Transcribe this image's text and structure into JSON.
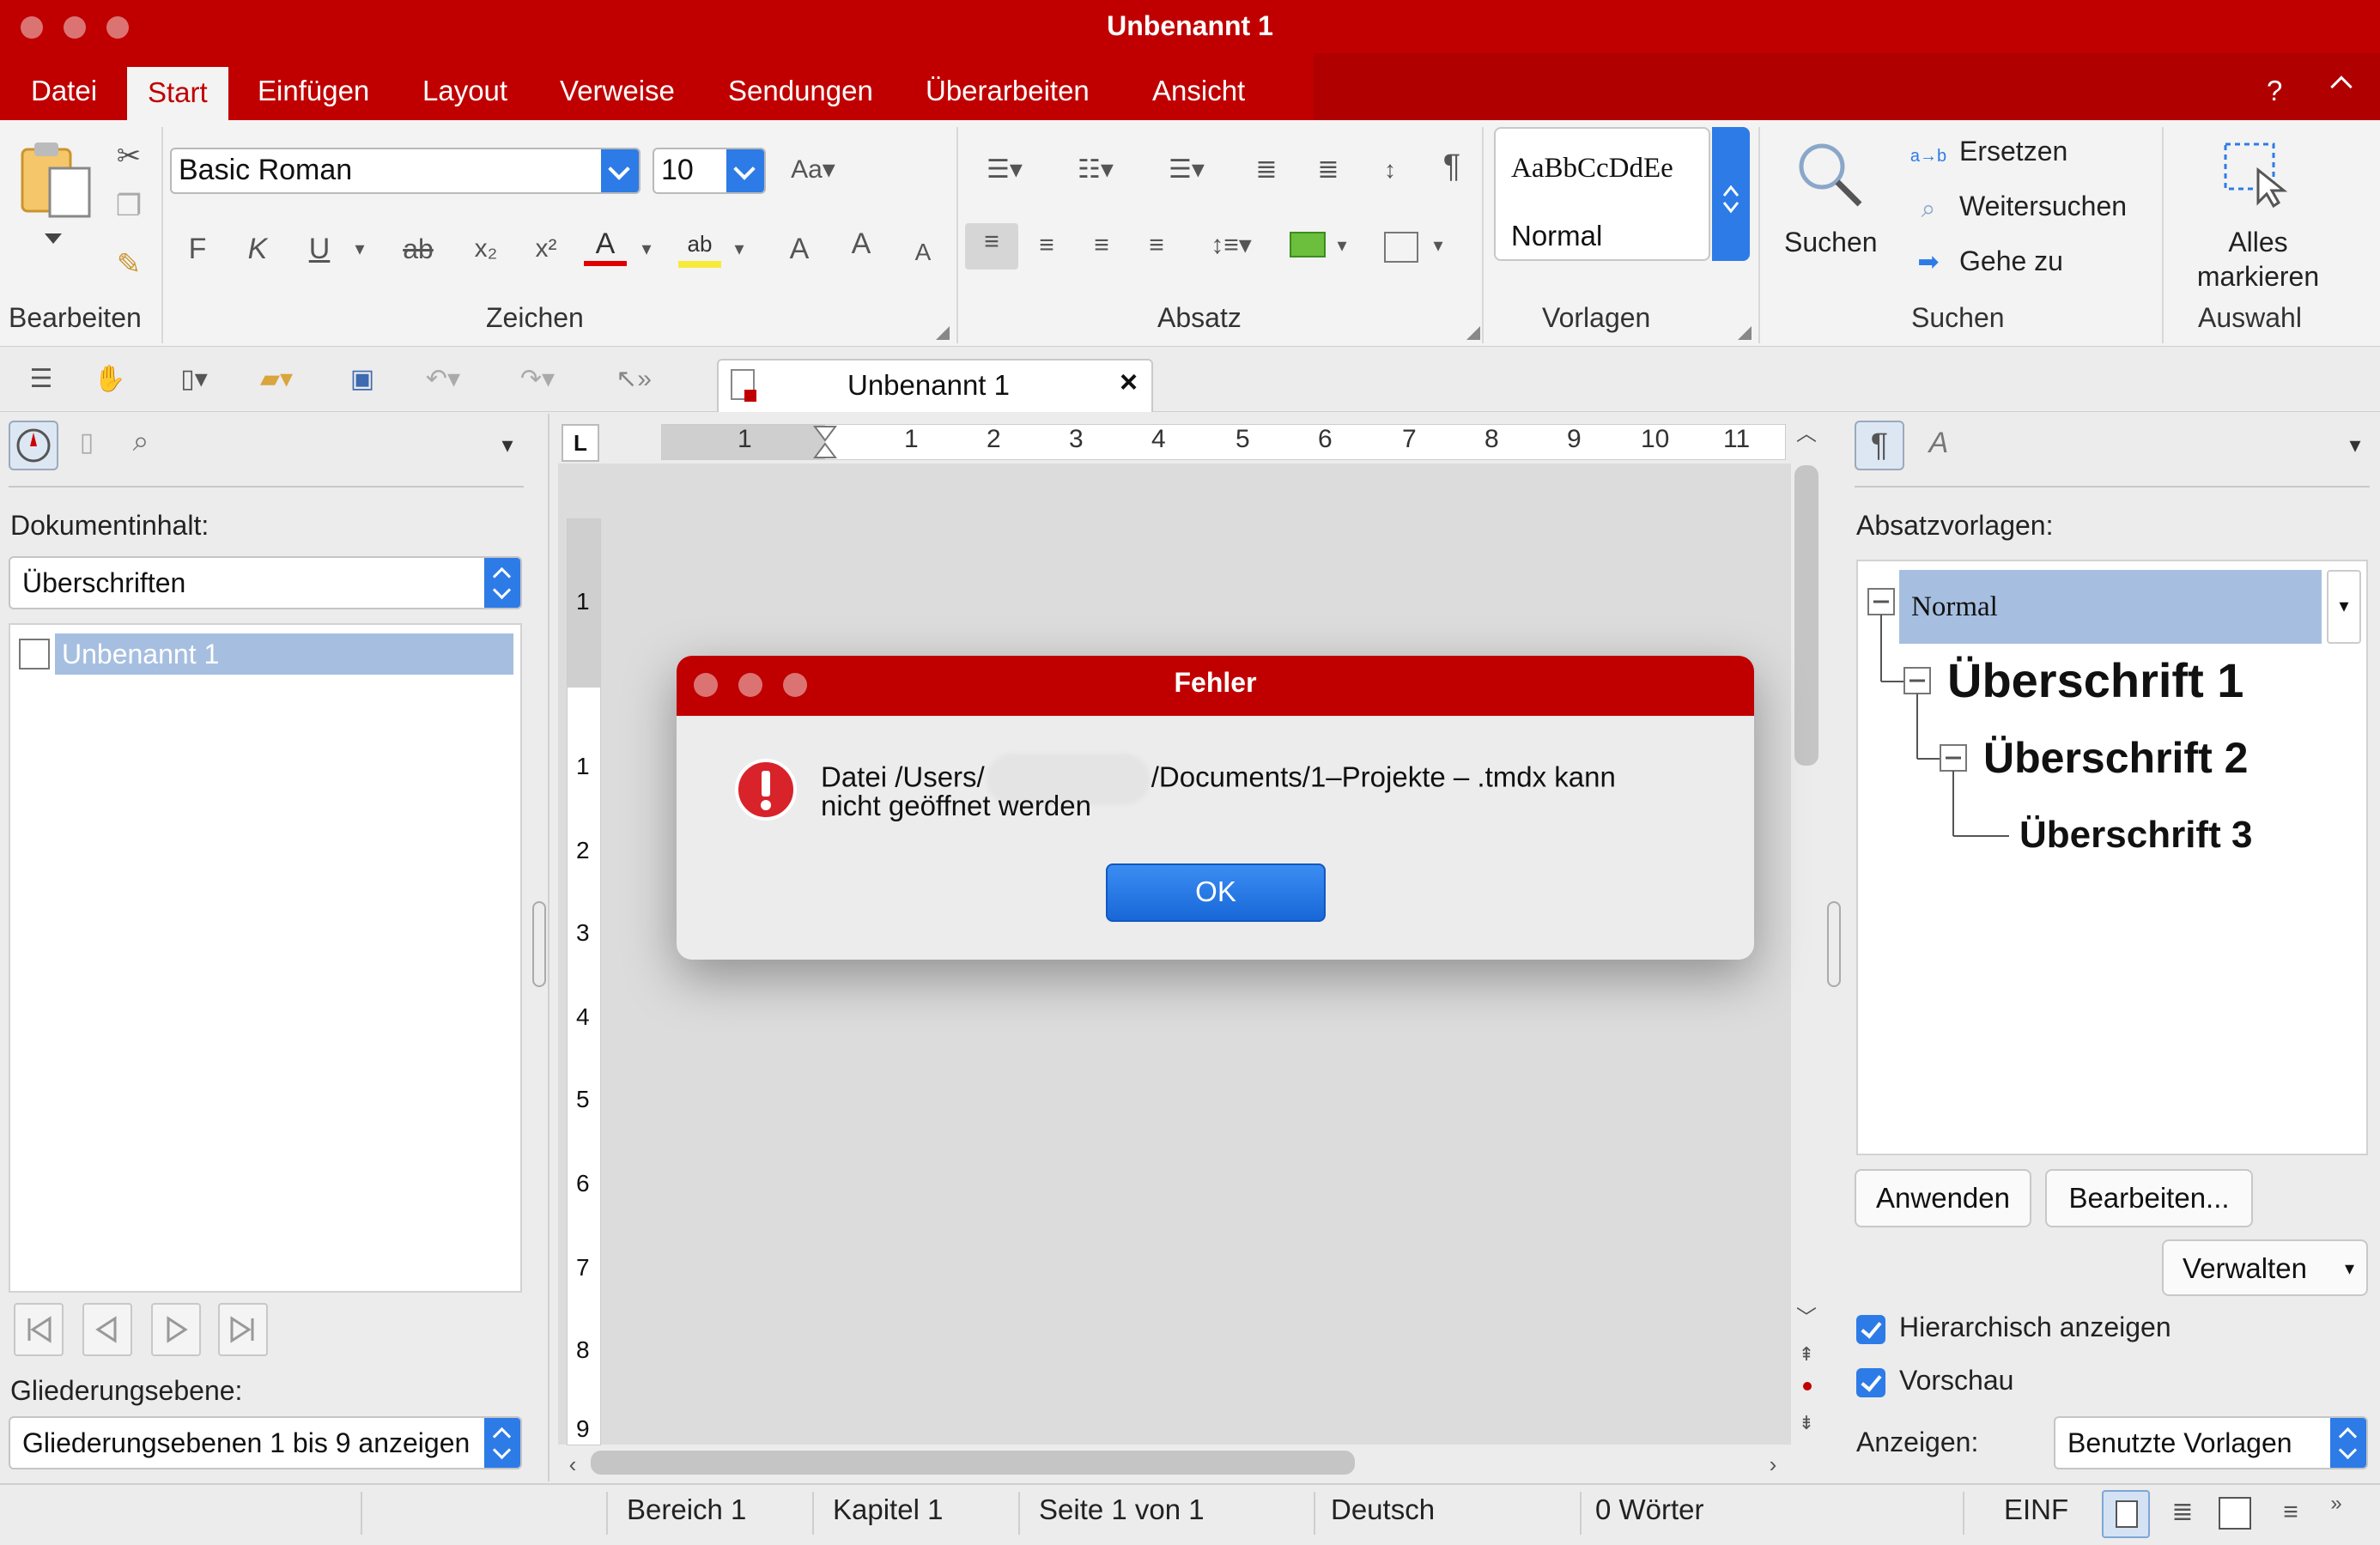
{
  "window": {
    "title": "Unbenannt 1"
  },
  "menu": {
    "items": [
      "Datei",
      "Start",
      "Einfügen",
      "Layout",
      "Verweise",
      "Sendungen",
      "Überarbeiten",
      "Ansicht"
    ],
    "help": "?"
  },
  "ribbon": {
    "font_name": "Basic Roman",
    "font_size": "10",
    "format_buttons": [
      "F",
      "K",
      "U"
    ],
    "style_preview": "AaBbCcDdEe",
    "style_name": "Normal",
    "search_label": "Suchen",
    "replace_label": "Ersetzen",
    "find_next_label": "Weitersuchen",
    "goto_label": "Gehe zu",
    "select_all_label": "Alles markieren",
    "groups": {
      "edit": "Bearbeiten",
      "chars": "Zeichen",
      "para": "Absatz",
      "styles": "Vorlagen",
      "search": "Suchen",
      "select": "Auswahl"
    }
  },
  "tab": {
    "label": "Unbenannt 1",
    "close": "×"
  },
  "ruler": {
    "unit_marker": "L",
    "marks": [
      "1",
      "1",
      "2",
      "3",
      "4",
      "5",
      "6",
      "7",
      "8",
      "9",
      "10",
      "11"
    ],
    "vmarks": [
      "1",
      "1",
      "2",
      "3",
      "4",
      "5",
      "6",
      "7",
      "8",
      "9"
    ]
  },
  "left_panel": {
    "doc_content_label": "Dokumentinhalt:",
    "content_select": "Überschriften",
    "tree_item": "Unbenannt 1",
    "outline_label": "Gliederungsebene:",
    "outline_select": "Gliederungsebenen 1 bis 9 anzeigen"
  },
  "dialog": {
    "title": "Fehler",
    "message_part1": "Datei /Users/",
    "message_part2": "/Documents/1–Projekte – .tmdx kann",
    "message_line2": "nicht geöffnet werden",
    "ok": "OK"
  },
  "right_panel": {
    "label": "Absatzvorlagen:",
    "styles": {
      "normal": "Normal",
      "h1": "Überschrift 1",
      "h2": "Überschrift 2",
      "h3": "Überschrift 3"
    },
    "apply": "Anwenden",
    "edit": "Bearbeiten...",
    "manage": "Verwalten",
    "hierarchical": "Hierarchisch anzeigen",
    "preview": "Vorschau",
    "show_label": "Anzeigen:",
    "show_select": "Benutzte Vorlagen"
  },
  "status": {
    "area": "Bereich 1",
    "chapter": "Kapitel 1",
    "page": "Seite 1 von 1",
    "language": "Deutsch",
    "words": "0 Wörter",
    "mode": "EINF"
  },
  "colors": {
    "brand": "#c00000",
    "accent": "#2d7be6"
  }
}
